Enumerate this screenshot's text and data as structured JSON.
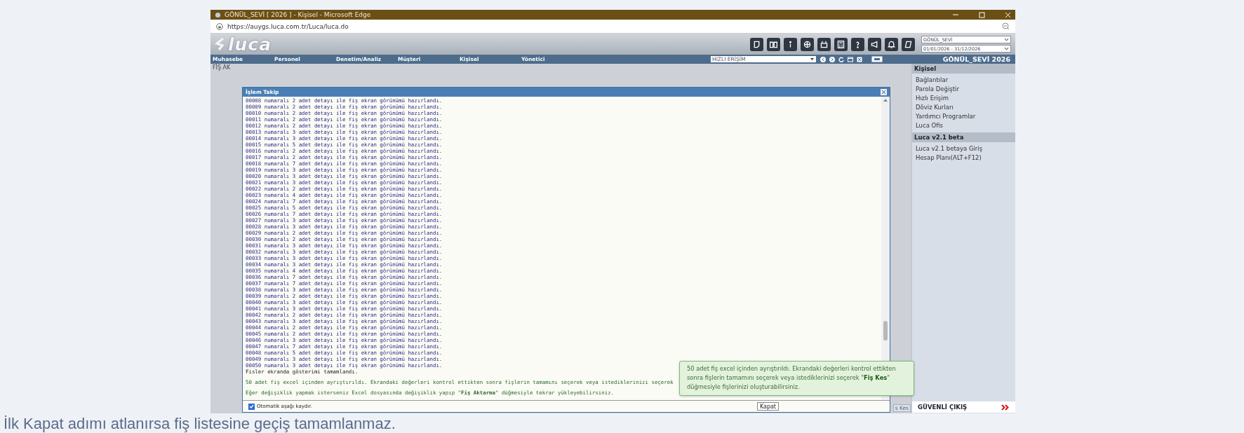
{
  "window": {
    "title": "GÖNÜL_SEVİ [ 2026 ] - Kişisel - Microsoft Edge"
  },
  "address_bar": {
    "url": "https://auygs.luca.com.tr/Luca/luca.do"
  },
  "header": {
    "logo": "luca",
    "company_select": "GÖNÜL_SEVİ",
    "period_select": "01/01/2026 - 31/12/2026"
  },
  "menu": {
    "items": [
      "Muhasebe",
      "Personel",
      "Denetim/Analiz",
      "Müşteri",
      "Kişisel",
      "Yönetici"
    ],
    "quick_access": "HIZLI ERİŞİM",
    "company_year": "GÖNÜL_SEVİ 2026"
  },
  "background_tab": "FİŞ AK",
  "background_button": "s Kes",
  "dialog": {
    "title": "İşlem Takip",
    "log_lines": [
      "00008 numaralı 2 adet detayı ile fiş ekran görünümü hazırlandı.",
      "00009 numaralı 2 adet detayı ile fiş ekran görünümü hazırlandı.",
      "00010 numaralı 2 adet detayı ile fiş ekran görünümü hazırlandı.",
      "00011 numaralı 2 adet detayı ile fiş ekran görünümü hazırlandı.",
      "00012 numaralı 2 adet detayı ile fiş ekran görünümü hazırlandı.",
      "00013 numaralı 3 adet detayı ile fiş ekran görünümü hazırlandı.",
      "00014 numaralı 3 adet detayı ile fiş ekran görünümü hazırlandı.",
      "00015 numaralı 5 adet detayı ile fiş ekran görünümü hazırlandı.",
      "00016 numaralı 2 adet detayı ile fiş ekran görünümü hazırlandı.",
      "00017 numaralı 2 adet detayı ile fiş ekran görünümü hazırlandı.",
      "00018 numaralı 7 adet detayı ile fiş ekran görünümü hazırlandı.",
      "00019 numaralı 3 adet detayı ile fiş ekran görünümü hazırlandı.",
      "00020 numaralı 3 adet detayı ile fiş ekran görünümü hazırlandı.",
      "00021 numaralı 3 adet detayı ile fiş ekran görünümü hazırlandı.",
      "00022 numaralı 2 adet detayı ile fiş ekran görünümü hazırlandı.",
      "00023 numaralı 4 adet detayı ile fiş ekran görünümü hazırlandı.",
      "00024 numaralı 7 adet detayı ile fiş ekran görünümü hazırlandı.",
      "00025 numaralı 5 adet detayı ile fiş ekran görünümü hazırlandı.",
      "00026 numaralı 7 adet detayı ile fiş ekran görünümü hazırlandı.",
      "00027 numaralı 3 adet detayı ile fiş ekran görünümü hazırlandı.",
      "00028 numaralı 3 adet detayı ile fiş ekran görünümü hazırlandı.",
      "00029 numaralı 2 adet detayı ile fiş ekran görünümü hazırlandı.",
      "00030 numaralı 2 adet detayı ile fiş ekran görünümü hazırlandı.",
      "00031 numaralı 3 adet detayı ile fiş ekran görünümü hazırlandı.",
      "00032 numaralı 3 adet detayı ile fiş ekran görünümü hazırlandı.",
      "00033 numaralı 3 adet detayı ile fiş ekran görünümü hazırlandı.",
      "00034 numaralı 3 adet detayı ile fiş ekran görünümü hazırlandı.",
      "00035 numaralı 4 adet detayı ile fiş ekran görünümü hazırlandı.",
      "00036 numaralı 7 adet detayı ile fiş ekran görünümü hazırlandı.",
      "00037 numaralı 7 adet detayı ile fiş ekran görünümü hazırlandı.",
      "00038 numaralı 3 adet detayı ile fiş ekran görünümü hazırlandı.",
      "00039 numaralı 2 adet detayı ile fiş ekran görünümü hazırlandı.",
      "00040 numaralı 3 adet detayı ile fiş ekran görünümü hazırlandı.",
      "00041 numaralı 3 adet detayı ile fiş ekran görünümü hazırlandı.",
      "00042 numaralı 2 adet detayı ile fiş ekran görünümü hazırlandı.",
      "00043 numaralı 3 adet detayı ile fiş ekran görünümü hazırlandı.",
      "00044 numaralı 2 adet detayı ile fiş ekran görünümü hazırlandı.",
      "00045 numaralı 2 adet detayı ile fiş ekran görünümü hazırlandı.",
      "00046 numaralı 3 adet detayı ile fiş ekran görünümü hazırlandı.",
      "00047 numaralı 7 adet detayı ile fiş ekran görünümü hazırlandı.",
      "00048 numaralı 5 adet detayı ile fiş ekran görünümü hazırlandı.",
      "00049 numaralı 3 adet detayı ile fiş ekran görünümü hazırlandı.",
      "00050 numaralı 3 adet detayı ile fiş ekran görünümü hazırlandı."
    ],
    "summary": "Fisler ekranda gösterimi tamamlandı.",
    "messages": [
      "50 adet fiş excel içinden ayrıştırıldı. Ekrandaki değerleri kontrol ettikten sonra fişlerin tamamını seçerek veya istediklerinizi seçerek",
      "Eğer değişiklik yapmak isterseniz Excel dosyasında değişiklik yapıp \"**Fiş Aktarma**\" düğmesiyle tekrar yükleyebilirsiniz."
    ],
    "auto_scroll": {
      "label": "Otomatik aşağı kaydır.",
      "checked": true
    },
    "close_button": "Kapat"
  },
  "sidebar": {
    "sections": [
      {
        "title": "Kişisel",
        "items": [
          "Bağlantılar",
          "Parola Değiştir",
          "Hızlı Erişim",
          "Döviz Kurları",
          "Yardımcı Programlar",
          "Luca Ofis"
        ]
      },
      {
        "title": "Luca v2.1 beta",
        "items": [
          "Luca v2.1 betaya Giriş",
          "Hesap Planı(ALT+F12)"
        ]
      }
    ],
    "logout": "GÜVENLİ ÇIKIŞ"
  },
  "tooltip": "50 adet fiş excel içinden ayrıştırıldı. Ekrandaki değerleri kontrol ettikten sonra fişlerin tamamını seçerek veya istediklerinizi seçerek \"**Fiş Kes**\" düğmesiyle fişlerinizi oluşturabilirsiniz.",
  "caption": "İlk Kapat adımı atlanırsa fiş listesine geçiş tamamlanmaz."
}
